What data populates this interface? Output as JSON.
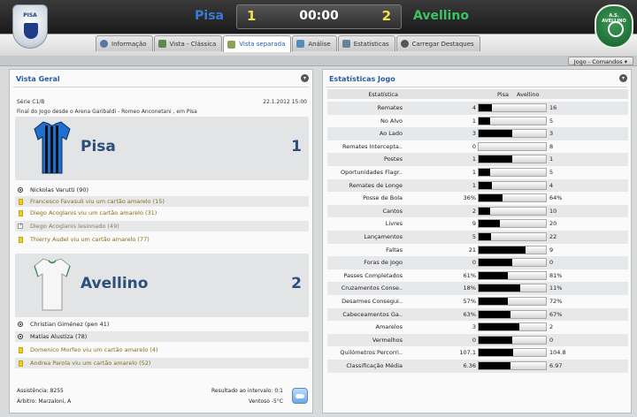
{
  "header": {
    "home_team": "Pisa",
    "away_team": "Avellino",
    "home_score": "1",
    "away_score": "2",
    "clock": "00:00",
    "home_crest_text": "PISA",
    "away_crest_text": "A.S. AVELLINO"
  },
  "tabs": [
    {
      "label": "Informação",
      "icon": "info-icon"
    },
    {
      "label": "Vista - Clássica",
      "icon": "grid-icon"
    },
    {
      "label": "Vista separada",
      "icon": "split-icon",
      "active": true
    },
    {
      "label": "Análise",
      "icon": "chart-icon"
    },
    {
      "label": "Estatísticas",
      "icon": "stats-icon"
    },
    {
      "label": "Carregar Destaques",
      "icon": "replay-icon"
    }
  ],
  "command_button": "Jogo - Comandos",
  "overview": {
    "title": "Vista Geral",
    "competition": "Série C1/B",
    "datetime": "22.1.2012 15:00",
    "venue": "Final do Jogo desde o Arena Garibaldi - Romeo Anconetani , em Pisa",
    "home": {
      "name": "Pisa",
      "goals": "1",
      "events": [
        {
          "type": "goal",
          "text": "Nickolas Varutti (90)"
        },
        {
          "type": "yellow",
          "text": "Francesco Favasuli viu um cartão amarelo (15)"
        },
        {
          "type": "yellow",
          "text": "Diego Acoglanis viu um cartão amarelo (31)"
        },
        {
          "type": "injury",
          "text": "Diego Acoglanis lesionado (49)"
        },
        {
          "type": "yellow",
          "text": "Thierry Audel viu um cartão amarelo (77)"
        }
      ]
    },
    "away": {
      "name": "Avellino",
      "goals": "2",
      "events": [
        {
          "type": "goal",
          "text": "Christian Giménez (pen 41)"
        },
        {
          "type": "goal",
          "text": "Matías Alustiza (78)"
        },
        {
          "type": "yellow",
          "text": "Domenico Morfeo viu um cartão amarelo (4)"
        },
        {
          "type": "yellow",
          "text": "Andrea Parola viu um cartão amarelo (52)"
        }
      ]
    },
    "attendance": "Assistência: 8255",
    "referee": "Árbitro: Marzaloni, A",
    "halftime": "Resultado ao intervalo: 0:1",
    "weather": "Ventoso -5°C"
  },
  "stats": {
    "title": "Estatísticas Jogo",
    "col_stat": "Estatística",
    "col_home": "Pisa",
    "col_away": "Avellino",
    "rows": [
      {
        "label": "Remates",
        "home": "4",
        "away": "16",
        "home_share": 0.2
      },
      {
        "label": "No Alvo",
        "home": "1",
        "away": "5",
        "home_share": 0.17
      },
      {
        "label": "Ao Lado",
        "home": "3",
        "away": "3",
        "home_share": 0.5
      },
      {
        "label": "Remates Intercepta..",
        "home": "0",
        "away": "8",
        "home_share": 0.0
      },
      {
        "label": "Postes",
        "home": "1",
        "away": "1",
        "home_share": 0.5
      },
      {
        "label": "Oportunidades Flagr..",
        "home": "1",
        "away": "5",
        "home_share": 0.17
      },
      {
        "label": "Remates de Longe",
        "home": "1",
        "away": "4",
        "home_share": 0.2
      },
      {
        "label": "Posse de Bola",
        "home": "36%",
        "away": "64%",
        "home_share": 0.36
      },
      {
        "label": "Cantos",
        "home": "2",
        "away": "10",
        "home_share": 0.17
      },
      {
        "label": "Livres",
        "home": "9",
        "away": "20",
        "home_share": 0.31
      },
      {
        "label": "Lançamentos",
        "home": "5",
        "away": "22",
        "home_share": 0.19
      },
      {
        "label": "Faltas",
        "home": "21",
        "away": "9",
        "home_share": 0.7
      },
      {
        "label": "Foras de Jogo",
        "home": "0",
        "away": "0",
        "home_share": 0.5
      },
      {
        "label": "Passes Completados",
        "home": "61%",
        "away": "81%",
        "home_share": 0.43
      },
      {
        "label": "Cruzamentos Conse..",
        "home": "18%",
        "away": "11%",
        "home_share": 0.62
      },
      {
        "label": "Desarmes Consegui..",
        "home": "57%",
        "away": "72%",
        "home_share": 0.44
      },
      {
        "label": "Cabeceamentos Ga..",
        "home": "63%",
        "away": "67%",
        "home_share": 0.48
      },
      {
        "label": "Amarelos",
        "home": "3",
        "away": "2",
        "home_share": 0.6
      },
      {
        "label": "Vermelhos",
        "home": "0",
        "away": "0",
        "home_share": 0.5
      },
      {
        "label": "Quilómetros Percorri..",
        "home": "107.1",
        "away": "104.8",
        "home_share": 0.51
      },
      {
        "label": "Classificação Média",
        "home": "6.36",
        "away": "6.97",
        "home_share": 0.48
      }
    ]
  },
  "colors": {
    "home_accent": "#3a7bd5",
    "away_accent": "#3fc165",
    "score": "#f3e04a",
    "title": "#2c5aa0"
  }
}
